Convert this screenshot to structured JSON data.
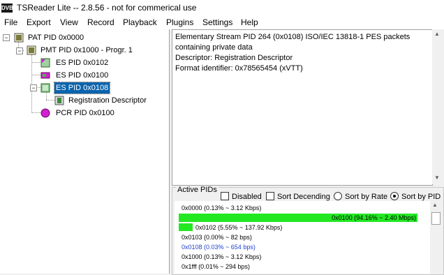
{
  "window": {
    "icon_text": "DVB",
    "title": "TSReader Lite -- 2.8.56 - not for commerical use"
  },
  "menu": [
    "File",
    "Export",
    "View",
    "Record",
    "Playback",
    "Plugins",
    "Settings",
    "Help"
  ],
  "tree": {
    "pat": "PAT PID 0x0000",
    "pmt": "PMT PID 0x1000 - Progr. 1",
    "es1": "ES PID 0x0102",
    "es2": "ES PID 0x0100",
    "es3": "ES PID 0x0108",
    "reg": "Registration Descriptor",
    "pcr": "PCR PID 0x0100"
  },
  "details": {
    "line1": "Elementary Stream PID 264 (0x0108) ISO/IEC 13818-1 PES packets",
    "line2": "containing private data",
    "line3": "Descriptor: Registration Descriptor",
    "line4": "Format identifier: 0x78565454 (xVTT)"
  },
  "active_pids": {
    "legend": "Active PIDs",
    "disabled_label": "Disabled",
    "sort_desc_label": "Sort Decending",
    "sort_rate_label": "Sort by Rate",
    "sort_pid_label": "Sort by PID",
    "selected_sort": "Sort by PID",
    "rows": [
      "0x0000 (0.13% ~ 3.12 Kbps)",
      "0x0100 (94.16% ~ 2.40 Mbps)",
      "0x0102 (5.55% ~ 137.92 Kbps)",
      "0x0103 (0.00% ~ 82 bps)",
      "0x0108 (0.03% ~ 654 bps)",
      "0x1000 (0.13% ~ 3.12 Kbps)",
      "0x1fff (0.01% ~ 294 bps)"
    ],
    "bar_fractions": [
      0.0013,
      0.9416,
      0.0555,
      0.0,
      0.0003,
      0.0013,
      0.0001
    ]
  },
  "colors": {
    "selection": "#0a64ad",
    "bar": "#22e822",
    "highlight_row": "#1f3fcf"
  }
}
